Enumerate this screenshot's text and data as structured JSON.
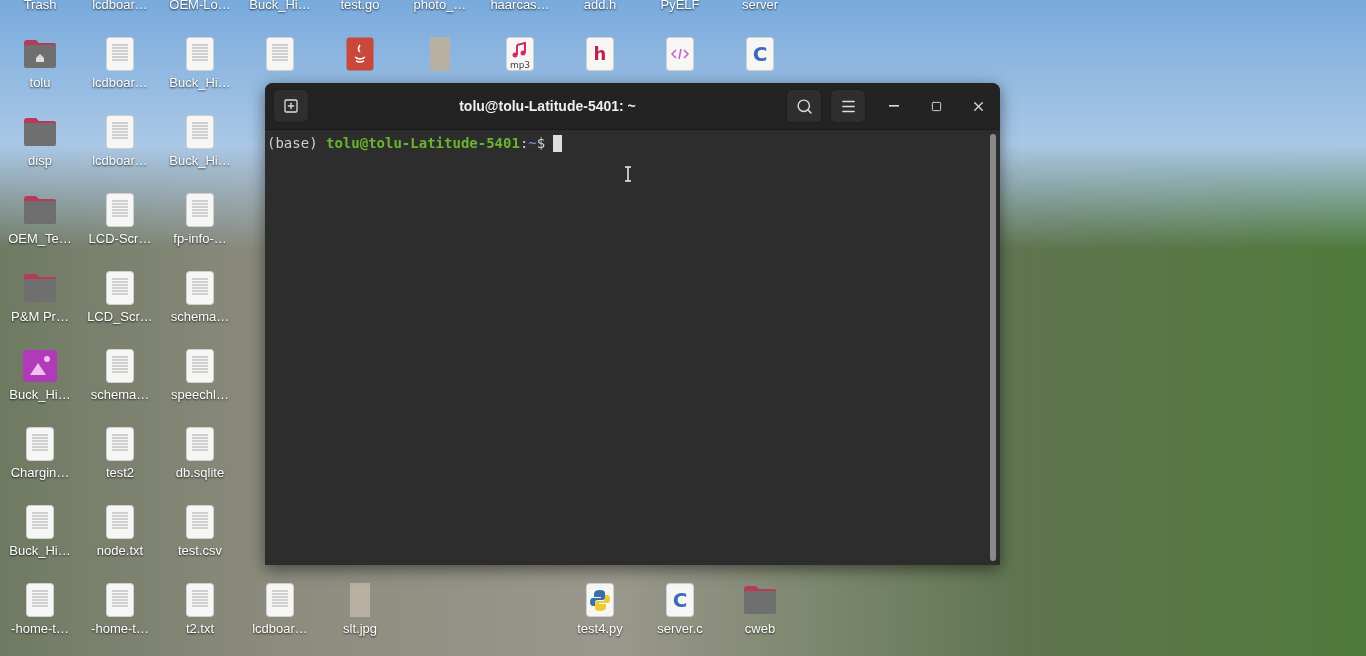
{
  "desktop": {
    "rows": [
      [
        {
          "label": "Trash"
        },
        {
          "label": "lcdboar…"
        },
        {
          "label": "OEM-Lo…"
        },
        {
          "label": "Buck_Hi…"
        },
        {
          "label": "test.go"
        },
        {
          "label": "photo_…"
        },
        {
          "label": "haarcas…"
        },
        {
          "label": "add.h"
        },
        {
          "label": "PyELF"
        },
        {
          "label": "server"
        }
      ],
      [
        {
          "label": "tolu",
          "kind": "home"
        },
        {
          "label": "lcdboar…",
          "kind": "text"
        },
        {
          "label": "Buck_Hi…",
          "kind": "text"
        },
        {
          "kind": "text"
        },
        {
          "kind": "java"
        },
        {
          "kind": "photo"
        },
        {
          "kind": "mp3",
          "glyph": "mp3"
        },
        {
          "kind": "h",
          "glyph": "h"
        },
        {
          "kind": "code"
        },
        {
          "kind": "c",
          "glyph": "C"
        }
      ],
      [
        {
          "label": "disp",
          "kind": "folder"
        },
        {
          "label": "lcdboar…",
          "kind": "text"
        },
        {
          "label": "Buck_Hi…",
          "kind": "text"
        }
      ],
      [
        {
          "label": "OEM_Te…",
          "kind": "folder"
        },
        {
          "label": "LCD-Scr…",
          "kind": "text"
        },
        {
          "label": "fp-info-…",
          "kind": "text"
        }
      ],
      [
        {
          "label": "P&M Pr…",
          "kind": "folder"
        },
        {
          "label": "LCD_Scr…",
          "kind": "text"
        },
        {
          "label": "schema…",
          "kind": "text"
        }
      ],
      [
        {
          "label": "Buck_Hi…",
          "kind": "image"
        },
        {
          "label": "schema…",
          "kind": "text"
        },
        {
          "label": "speechl…",
          "kind": "text"
        }
      ],
      [
        {
          "label": "Chargin…",
          "kind": "text"
        },
        {
          "label": "test2",
          "kind": "text"
        },
        {
          "label": "db.sqlite",
          "kind": "text"
        }
      ],
      [
        {
          "label": "Buck_Hi…",
          "kind": "text"
        },
        {
          "label": "node.txt",
          "kind": "text"
        },
        {
          "label": "test.csv",
          "kind": "text"
        }
      ],
      [
        {
          "label": "-home-t…",
          "kind": "text"
        },
        {
          "label": "-home-t…",
          "kind": "text"
        },
        {
          "label": "t2.txt",
          "kind": "text"
        },
        {
          "label": "lcdboar…",
          "kind": "text"
        },
        {
          "label": "slt.jpg",
          "kind": "photo"
        },
        null,
        null,
        {
          "label": "test4.py",
          "kind": "python"
        },
        {
          "label": "server.c",
          "kind": "c",
          "glyph": "C"
        },
        {
          "label": "cweb",
          "kind": "folder"
        }
      ]
    ]
  },
  "terminal": {
    "title": "tolu@tolu-Latitude-5401: ~",
    "prompt": {
      "env": "(base)",
      "user_host": "tolu@tolu-Latitude-5401",
      "separator": ":",
      "path": "~",
      "symbol": "$"
    }
  }
}
